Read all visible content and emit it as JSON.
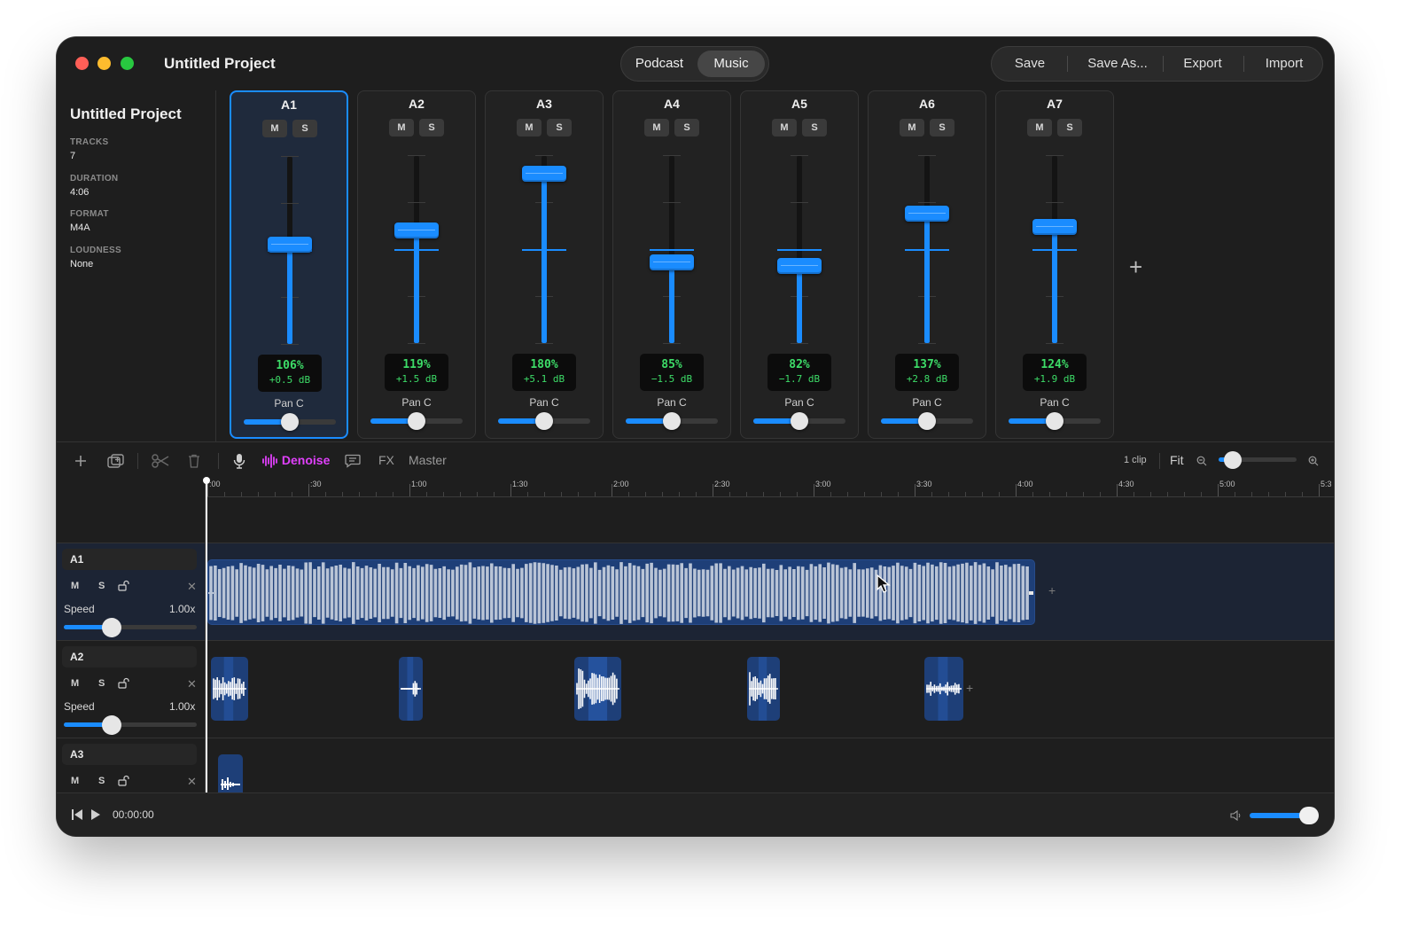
{
  "window": {
    "title": "Untitled Project"
  },
  "mode_switch": {
    "options": [
      "Podcast",
      "Music"
    ],
    "selected": "Music"
  },
  "actions": {
    "save": "Save",
    "save_as": "Save As...",
    "export": "Export",
    "import": "Import"
  },
  "info": {
    "title": "Untitled Project",
    "tracks_label": "TRACKS",
    "tracks": "7",
    "duration_label": "DURATION",
    "duration": "4:06",
    "format_label": "FORMAT",
    "format": "M4A",
    "loudness_label": "LOUDNESS",
    "loudness": "None"
  },
  "mixer": {
    "mute_label": "M",
    "solo_label": "S",
    "channels": [
      {
        "name": "A1",
        "gain_pct": "106%",
        "gain_db": "+0.5 dB",
        "pan": "Pan C",
        "fader_level": 0.53,
        "selected": true
      },
      {
        "name": "A2",
        "gain_pct": "119%",
        "gain_db": "+1.5 dB",
        "pan": "Pan C",
        "fader_level": 0.6,
        "selected": false
      },
      {
        "name": "A3",
        "gain_pct": "180%",
        "gain_db": "+5.1 dB",
        "pan": "Pan C",
        "fader_level": 0.9,
        "selected": false
      },
      {
        "name": "A4",
        "gain_pct": "85%",
        "gain_db": "−1.5 dB",
        "pan": "Pan C",
        "fader_level": 0.43,
        "selected": false
      },
      {
        "name": "A5",
        "gain_pct": "82%",
        "gain_db": "−1.7 dB",
        "pan": "Pan C",
        "fader_level": 0.41,
        "selected": false
      },
      {
        "name": "A6",
        "gain_pct": "137%",
        "gain_db": "+2.8 dB",
        "pan": "Pan C",
        "fader_level": 0.69,
        "selected": false
      },
      {
        "name": "A7",
        "gain_pct": "124%",
        "gain_db": "+1.9 dB",
        "pan": "Pan C",
        "fader_level": 0.62,
        "selected": false
      }
    ]
  },
  "toolbar": {
    "denoise": "Denoise",
    "fx": "FX",
    "master": "Master",
    "clip_count": "1 clip",
    "fit": "Fit",
    "zoom_level": 0.1
  },
  "ruler": {
    "labels": [
      ":00",
      ":30",
      "1:00",
      "1:30",
      "2:00",
      "2:30",
      "3:00",
      "3:30",
      "4:00",
      "4:30",
      "5:00",
      "5:3"
    ]
  },
  "tracks": [
    {
      "name": "A1",
      "mute": "M",
      "solo": "S",
      "speed_label": "Speed",
      "speed": "1.00x"
    },
    {
      "name": "A2",
      "mute": "M",
      "solo": "S",
      "speed_label": "Speed",
      "speed": "1.00x"
    },
    {
      "name": "A3",
      "mute": "M",
      "solo": "S"
    }
  ],
  "transport": {
    "time": "00:00:00",
    "volume": 0.85
  },
  "colors": {
    "accent": "#1a8cff",
    "meter_green": "#3ddc68",
    "denoise_pink": "#e040fb",
    "clip_bg": "#1e3f78"
  }
}
